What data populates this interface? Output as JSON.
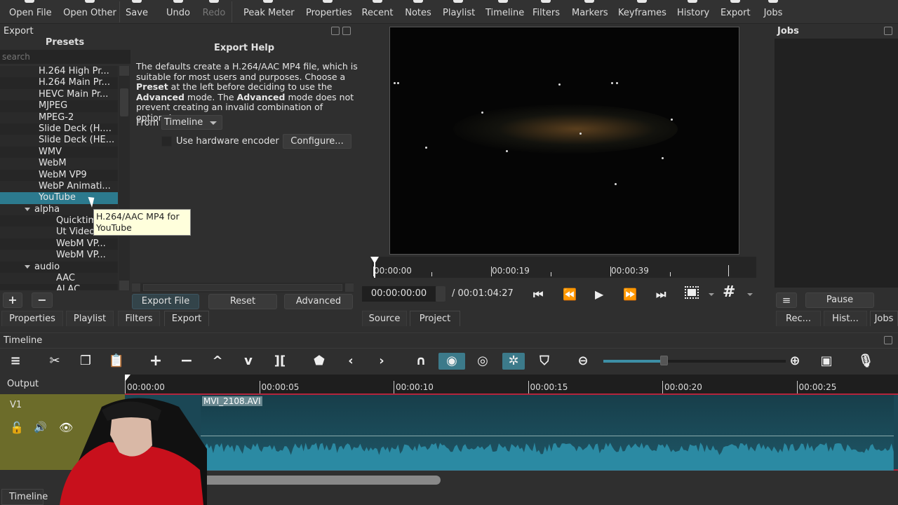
{
  "toolbar": {
    "items": [
      {
        "label": "Open File",
        "icon": "open-file-icon"
      },
      {
        "label": "Open Other",
        "icon": "open-other-icon"
      },
      {
        "label": "Save",
        "icon": "save-icon"
      },
      {
        "label": "Undo",
        "icon": "undo-icon"
      },
      {
        "label": "Redo",
        "icon": "redo-icon",
        "disabled": true
      },
      {
        "label": "Peak Meter",
        "icon": "peak-meter-icon"
      },
      {
        "label": "Properties",
        "icon": "properties-icon"
      },
      {
        "label": "Recent",
        "icon": "recent-icon"
      },
      {
        "label": "Notes",
        "icon": "notes-icon"
      },
      {
        "label": "Playlist",
        "icon": "playlist-icon"
      },
      {
        "label": "Timeline",
        "icon": "timeline-icon"
      },
      {
        "label": "Filters",
        "icon": "filters-icon"
      },
      {
        "label": "Markers",
        "icon": "markers-icon"
      },
      {
        "label": "Keyframes",
        "icon": "keyframes-icon"
      },
      {
        "label": "History",
        "icon": "history-icon"
      },
      {
        "label": "Export",
        "icon": "export-icon"
      },
      {
        "label": "Jobs",
        "icon": "jobs-icon"
      }
    ]
  },
  "export_panel": {
    "title": "Export",
    "presets_label": "Presets",
    "search_placeholder": "search",
    "presets": [
      {
        "label": "H.264 High Pr...",
        "level": 1
      },
      {
        "label": "H.264 Main Pr...",
        "level": 1
      },
      {
        "label": "HEVC Main Pr...",
        "level": 1
      },
      {
        "label": "MJPEG",
        "level": 1
      },
      {
        "label": "MPEG-2",
        "level": 1
      },
      {
        "label": "Slide Deck (H....",
        "level": 1
      },
      {
        "label": "Slide Deck (HE...",
        "level": 1
      },
      {
        "label": "WMV",
        "level": 1
      },
      {
        "label": "WebM",
        "level": 1
      },
      {
        "label": "WebM VP9",
        "level": 1
      },
      {
        "label": "WebP Animati...",
        "level": 1
      },
      {
        "label": "YouTube",
        "level": 1,
        "selected": true
      },
      {
        "label": "alpha",
        "level": 1,
        "group": true
      },
      {
        "label": "Quicktime...",
        "level": 2
      },
      {
        "label": "Ut Video...",
        "level": 2
      },
      {
        "label": "WebM VP...",
        "level": 2
      },
      {
        "label": "WebM VP...",
        "level": 2
      },
      {
        "label": "audio",
        "level": 1,
        "group": true
      },
      {
        "label": "AAC",
        "level": 2
      },
      {
        "label": "ALAC",
        "level": 2
      }
    ],
    "tooltip": "H.264/AAC MP4 for YouTube",
    "help_title": "Export Help",
    "help_parts": [
      {
        "t": "The defaults create a H.264/AAC MP4 file, which is suitable for most users and purposes. Choose a ",
        "b": false
      },
      {
        "t": "Preset",
        "b": true
      },
      {
        "t": " at the left before deciding to use the ",
        "b": false
      },
      {
        "t": "Advanced",
        "b": true
      },
      {
        "t": " mode. The ",
        "b": false
      },
      {
        "t": "Advanced",
        "b": true
      },
      {
        "t": " mode does not prevent creating an invalid combination of options!",
        "b": false
      }
    ],
    "from_label": "From",
    "from_value": "Timeline",
    "hw_encoder_label": "Use hardware encoder",
    "hw_encoder_checked": false,
    "configure_label": "Configure...",
    "add_label": "+",
    "remove_label": "−",
    "export_file_label": "Export File",
    "reset_label": "Reset",
    "advanced_label": "Advanced"
  },
  "left_tabs": [
    "Properties",
    "Playlist",
    "Filters",
    "Export"
  ],
  "left_active_tab": "Export",
  "player": {
    "ruler_labels": [
      "00:00:00",
      "00:00:19",
      "00:00:39"
    ],
    "timecode": "00:00:00:00",
    "duration": "/ 00:01:04:27",
    "tabs": [
      "Source",
      "Project"
    ],
    "active_tab": "Project"
  },
  "jobs_panel": {
    "title": "Jobs",
    "pause_label": "Pause",
    "tabs": [
      "Rec...",
      "Hist...",
      "Jobs"
    ],
    "active_tab": "Jobs"
  },
  "timeline": {
    "title": "Timeline",
    "output_label": "Output",
    "ruler_labels": [
      "00:00:00",
      "00:00:05",
      "00:00:10",
      "00:00:15",
      "00:00:20",
      "00:00:25"
    ],
    "track_name": "V1",
    "clip_name": "MVI_2108.AVI",
    "zoom_level": 0.33,
    "bottom_tab": "Timeline",
    "colors": {
      "accent": "#2c7a8e",
      "clip": "#1e5666",
      "waveform": "#2b8aa3",
      "track_border": "#b3253c",
      "track_head": "#6c6c2a"
    }
  }
}
